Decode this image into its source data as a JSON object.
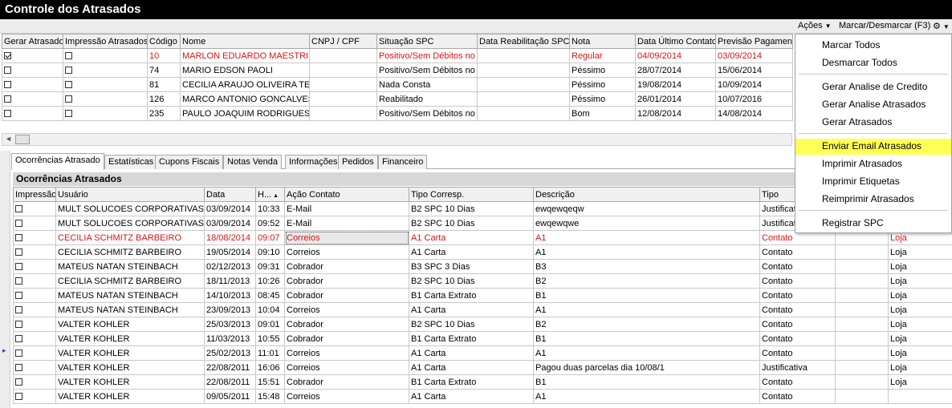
{
  "window": {
    "title": "Controle dos Atrasados"
  },
  "toolbar": {
    "acoes": "Ações",
    "marcar": "Marcar/Desmarcar (F3)"
  },
  "top_grid": {
    "headers": [
      "Gerar Atrasado",
      "Impressão Atrasados",
      "Código",
      "Nome",
      "CNPJ / CPF",
      "Situação SPC",
      "Data Reabilitação SPC",
      "Nota",
      "Data Último Contato",
      "Previsão Pagamento"
    ],
    "rows": [
      {
        "gerar": true,
        "impressao": false,
        "codigo": "10",
        "nome": "MARLON EDUARDO MAESTRI",
        "cnpj": "",
        "situacao": "Positivo/Sem Débitos no S",
        "reab": "",
        "nota": "Regular",
        "ultimo": "04/09/2014",
        "previsao": "03/09/2014",
        "highlight": true
      },
      {
        "gerar": false,
        "impressao": false,
        "codigo": "74",
        "nome": "MARIO EDSON PAOLI",
        "cnpj": "",
        "situacao": "Positivo/Sem Débitos no S",
        "reab": "",
        "nota": "Péssimo",
        "ultimo": "28/07/2014",
        "previsao": "15/06/2014",
        "highlight": false
      },
      {
        "gerar": false,
        "impressao": false,
        "codigo": "81",
        "nome": "CECILIA ARAUJO OLIVEIRA TEL",
        "cnpj": "",
        "situacao": "Nada Consta",
        "reab": "",
        "nota": "Péssimo",
        "ultimo": "19/08/2014",
        "previsao": "10/09/2014",
        "highlight": false
      },
      {
        "gerar": false,
        "impressao": false,
        "codigo": "126",
        "nome": "MARCO ANTONIO GONCALVES",
        "cnpj": "",
        "situacao": "Reabilitado",
        "reab": "",
        "nota": "Péssimo",
        "ultimo": "26/01/2014",
        "previsao": "10/07/2016",
        "highlight": false
      },
      {
        "gerar": false,
        "impressao": false,
        "codigo": "235",
        "nome": "PAULO JOAQUIM RODRIGUES",
        "cnpj": "",
        "situacao": "Positivo/Sem Débitos no S",
        "reab": "",
        "nota": "Bom",
        "ultimo": "12/08/2014",
        "previsao": "14/08/2014",
        "highlight": false
      }
    ]
  },
  "tabs": [
    "Ocorrências Atrasado",
    "Estatísticas",
    "Cupons Fiscais",
    "Notas Venda",
    "Informações",
    "Pedidos",
    "Financeiro"
  ],
  "section_title": "Ocorrências Atrasados",
  "bottom_grid": {
    "headers": [
      "Impressão",
      "Usuário",
      "Data",
      "H...",
      "Ação Contato",
      "Tipo Corresp.",
      "Descrição",
      "Tipo",
      "",
      ""
    ],
    "rows": [
      {
        "usuario": "MULT SOLUCOES CORPORATIVAS",
        "data": "03/09/2014",
        "hora": "10:33",
        "acao": "E-Mail",
        "tipo_corresp": "B2 SPC 10 Dias",
        "descricao": "ewqewqeqw",
        "tipo": "Justificat",
        "extra": "",
        "highlight": false
      },
      {
        "usuario": "MULT SOLUCOES CORPORATIVAS",
        "data": "03/09/2014",
        "hora": "09:52",
        "acao": "E-Mail",
        "tipo_corresp": "B2 SPC 10 Dias",
        "descricao": "ewqewqwe",
        "tipo": "Justificat",
        "extra": "",
        "highlight": false
      },
      {
        "usuario": "CECILIA SCHMITZ BARBEIRO",
        "data": "18/08/2014",
        "hora": "09:07",
        "acao": "Correios",
        "tipo_corresp": "A1 Carta",
        "descricao": "A1",
        "tipo": "Contato",
        "extra": "Loja",
        "highlight": true
      },
      {
        "usuario": "CECILIA SCHMITZ BARBEIRO",
        "data": "19/05/2014",
        "hora": "09:10",
        "acao": "Correios",
        "tipo_corresp": "A1 Carta",
        "descricao": "A1",
        "tipo": "Contato",
        "extra": "Loja",
        "highlight": false
      },
      {
        "usuario": "MATEUS NATAN STEINBACH",
        "data": "02/12/2013",
        "hora": "09:31",
        "acao": "Cobrador",
        "tipo_corresp": "B3 SPC 3 Dias",
        "descricao": "B3",
        "tipo": "Contato",
        "extra": "Loja",
        "highlight": false
      },
      {
        "usuario": "CECILIA SCHMITZ BARBEIRO",
        "data": "18/11/2013",
        "hora": "10:26",
        "acao": "Cobrador",
        "tipo_corresp": "B2 SPC 10 Dias",
        "descricao": "B2",
        "tipo": "Contato",
        "extra": "Loja",
        "highlight": false
      },
      {
        "usuario": "MATEUS NATAN STEINBACH",
        "data": "14/10/2013",
        "hora": "08:45",
        "acao": "Cobrador",
        "tipo_corresp": "B1 Carta Extrato",
        "descricao": "B1",
        "tipo": "Contato",
        "extra": "Loja",
        "highlight": false
      },
      {
        "usuario": "MATEUS NATAN STEINBACH",
        "data": "23/09/2013",
        "hora": "10:04",
        "acao": "Correios",
        "tipo_corresp": "A1 Carta",
        "descricao": "A1",
        "tipo": "Contato",
        "extra": "Loja",
        "highlight": false
      },
      {
        "usuario": "VALTER KOHLER",
        "data": "25/03/2013",
        "hora": "09:01",
        "acao": "Cobrador",
        "tipo_corresp": "B2 SPC 10 Dias",
        "descricao": "B2",
        "tipo": "Contato",
        "extra": "Loja",
        "highlight": false
      },
      {
        "usuario": "VALTER KOHLER",
        "data": "11/03/2013",
        "hora": "10:55",
        "acao": "Cobrador",
        "tipo_corresp": "B1 Carta Extrato",
        "descricao": "B1",
        "tipo": "Contato",
        "extra": "Loja",
        "highlight": false
      },
      {
        "usuario": "VALTER KOHLER",
        "data": "25/02/2013",
        "hora": "11:01",
        "acao": "Correios",
        "tipo_corresp": "A1 Carta",
        "descricao": "A1",
        "tipo": "Contato",
        "extra": "Loja",
        "highlight": false
      },
      {
        "usuario": "VALTER KOHLER",
        "data": "22/08/2011",
        "hora": "16:06",
        "acao": "Correios",
        "tipo_corresp": "A1 Carta",
        "descricao": "Pagou duas parcelas dia 10/08/1",
        "tipo": "Justificativa",
        "extra": "Loja",
        "highlight": false
      },
      {
        "usuario": "VALTER KOHLER",
        "data": "22/08/2011",
        "hora": "15:51",
        "acao": "Cobrador",
        "tipo_corresp": "B1 Carta Extrato",
        "descricao": "B1",
        "tipo": "Contato",
        "extra": "Loja",
        "highlight": false
      },
      {
        "usuario": "VALTER KOHLER",
        "data": "09/05/2011",
        "hora": "15:48",
        "acao": "Correios",
        "tipo_corresp": "A1 Carta",
        "descricao": "A1",
        "tipo": "Contato",
        "extra": "",
        "highlight": false
      }
    ]
  },
  "menu": {
    "items": [
      "Marcar Todos",
      "Desmarcar Todos",
      "Gerar Analise de Credito",
      "Gerar Analise Atrasados",
      "Gerar Atrasados",
      "Enviar Email Atrasados",
      "Imprimir Atrasados",
      "Imprimir Etiquetas",
      "Reimprimir Atrasados",
      "Registrar SPC"
    ],
    "highlighted_index": 5
  },
  "colors": {
    "highlight_row": "#e01010",
    "menu_highlight": "#ffff55",
    "title_bg": "#000000"
  }
}
